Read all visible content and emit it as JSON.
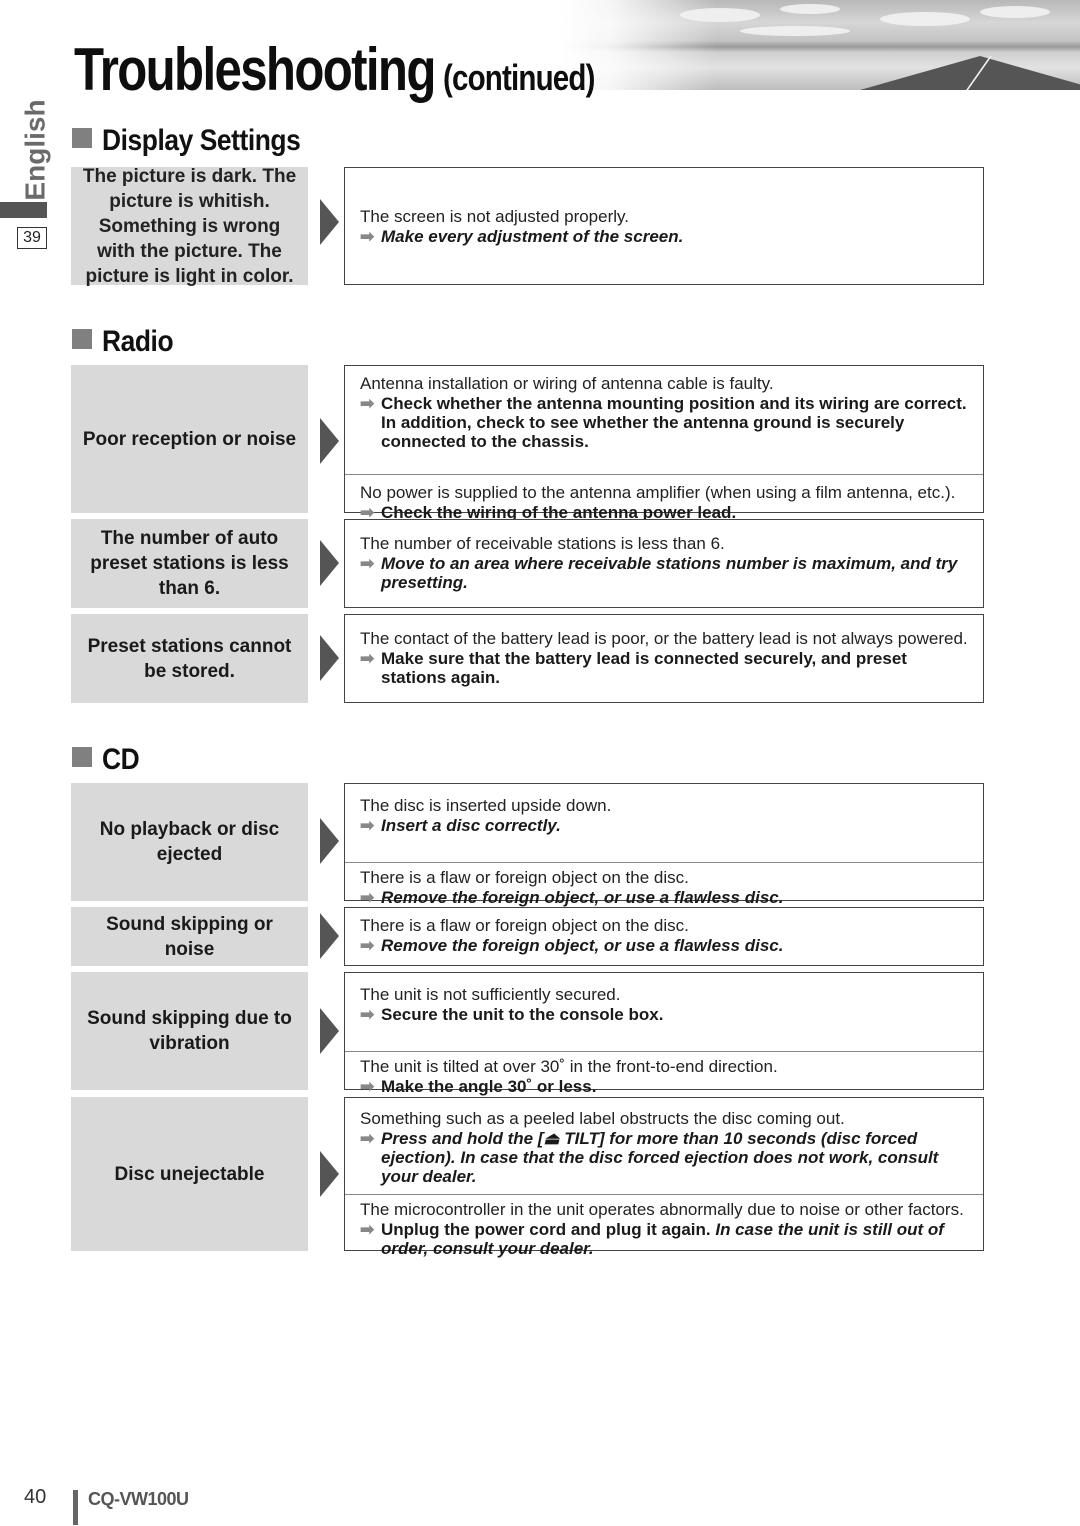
{
  "header": {
    "title": "Troubleshooting",
    "title_suffix": "(continued)",
    "banner_image": "road-landscape-photo"
  },
  "sidebar": {
    "language": "English",
    "page_ref": "39"
  },
  "sections": [
    {
      "heading": "Display Settings",
      "rows": [
        {
          "symptom": "The picture is dark. The picture is whitish. Something is wrong with the picture. The picture is light in color.",
          "items": [
            {
              "cause": "The screen is not adjusted properly.",
              "remedy": "Make every adjustment of the screen.",
              "remedy_style": "bold-italic"
            }
          ]
        }
      ]
    },
    {
      "heading": "Radio",
      "rows": [
        {
          "symptom": "Poor reception or noise",
          "items": [
            {
              "cause": "Antenna installation or wiring of antenna cable is faulty.",
              "remedy": "Check whether the antenna mounting position and its wiring are correct. In addition, check to see whether the antenna ground is securely connected to the chassis.",
              "remedy_style": "bold"
            },
            {
              "cause": "No power is supplied to the antenna amplifier (when using a film antenna, etc.).",
              "remedy": "Check the wiring of the antenna power lead.",
              "remedy_style": "bold"
            }
          ]
        },
        {
          "symptom": "The number of auto preset stations is less than 6.",
          "items": [
            {
              "cause": "The number of receivable stations is less than 6.",
              "remedy": "Move to an area where receivable stations number is maximum, and try presetting.",
              "remedy_style": "bold-italic"
            }
          ]
        },
        {
          "symptom": "Preset stations cannot be stored.",
          "items": [
            {
              "cause": "The contact of the battery lead is poor, or the battery lead is not always powered.",
              "remedy": "Make sure that the battery lead is connected securely, and preset stations again.",
              "remedy_style": "bold"
            }
          ]
        }
      ]
    },
    {
      "heading": "CD",
      "rows": [
        {
          "symptom": "No playback or disc ejected",
          "items": [
            {
              "cause": "The disc is inserted upside down.",
              "remedy": "Insert a disc correctly.",
              "remedy_style": "bold-italic"
            },
            {
              "cause": "There is a flaw or foreign object on the disc.",
              "remedy": "Remove the foreign object, or use a flawless disc.",
              "remedy_style": "bold-italic"
            }
          ]
        },
        {
          "symptom": "Sound skipping or noise",
          "items": [
            {
              "cause": "There is a flaw or foreign object on the disc.",
              "remedy": "Remove the foreign object, or use a flawless disc.",
              "remedy_style": "bold-italic"
            }
          ]
        },
        {
          "symptom": "Sound skipping due to vibration",
          "items": [
            {
              "cause": "The unit is not sufficiently secured.",
              "remedy": "Secure the unit to the console box.",
              "remedy_style": "bold"
            },
            {
              "cause": "The unit is tilted at over 30˚ in the front-to-end direction.",
              "remedy": "Make the angle 30˚ or less.",
              "remedy_style": "bold"
            }
          ]
        },
        {
          "symptom": "Disc unejectable",
          "items": [
            {
              "cause": "Something such as a peeled label obstructs the disc coming out.",
              "remedy": "Press and hold the [⏏ TILT] for more than 10 seconds (disc forced ejection). In case that the disc forced ejection does not work, consult your dealer.",
              "remedy_style": "bold-italic"
            },
            {
              "cause": "The microcontroller in the unit operates abnormally due to noise or other factors.",
              "remedy": "Unplug the power cord and plug it again.",
              "remedy_extra": "In case the unit is still out of order, consult your dealer.",
              "remedy_style": "bold"
            }
          ]
        }
      ]
    }
  ],
  "icons": {
    "remedy_arrow": "➡",
    "row_pointer": "triangle-right"
  },
  "footer": {
    "page_number": "40",
    "model": "CQ-VW100U"
  }
}
